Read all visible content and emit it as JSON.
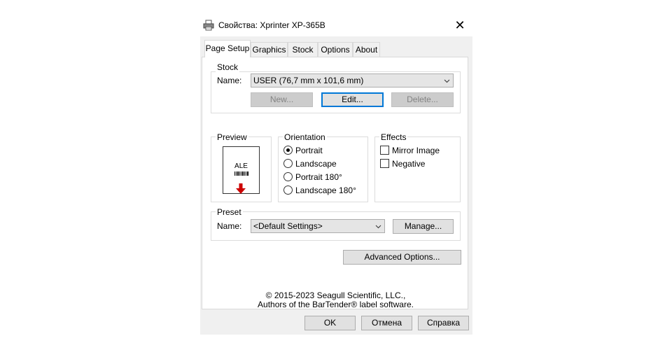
{
  "window": {
    "title": "Свойства: Xprinter XP-365B",
    "close_glyph": "✕"
  },
  "tabs": [
    {
      "label": "Page Setup",
      "active": true
    },
    {
      "label": "Graphics",
      "active": false
    },
    {
      "label": "Stock",
      "active": false
    },
    {
      "label": "Options",
      "active": false
    },
    {
      "label": "About",
      "active": false
    }
  ],
  "stock": {
    "legend": "Stock",
    "name_label": "Name:",
    "name_value": "USER (76,7 mm x 101,6 mm)",
    "new_label": "New...",
    "edit_label": "Edit...",
    "delete_label": "Delete..."
  },
  "preview": {
    "legend": "Preview",
    "sample_text": "ALE",
    "arrow_color": "#cc0000"
  },
  "orientation": {
    "legend": "Orientation",
    "options": [
      {
        "label": "Portrait",
        "checked": true
      },
      {
        "label": "Landscape",
        "checked": false
      },
      {
        "label": "Portrait 180°",
        "checked": false
      },
      {
        "label": "Landscape 180°",
        "checked": false
      }
    ]
  },
  "effects": {
    "legend": "Effects",
    "options": [
      {
        "label": "Mirror Image",
        "checked": false
      },
      {
        "label": "Negative",
        "checked": false
      }
    ]
  },
  "preset": {
    "legend": "Preset",
    "name_label": "Name:",
    "name_value": "<Default Settings>",
    "manage_label": "Manage..."
  },
  "advanced_label": "Advanced Options...",
  "footer": {
    "line1": "© 2015-2023 Seagull Scientific, LLC.,",
    "line2": "Authors of the BarTender® label software."
  },
  "buttons": {
    "ok": "OK",
    "cancel": "Отмена",
    "help": "Справка"
  },
  "icons": {
    "title": "printer-icon",
    "close": "close-icon",
    "dropdown": "chevron-down-icon"
  }
}
